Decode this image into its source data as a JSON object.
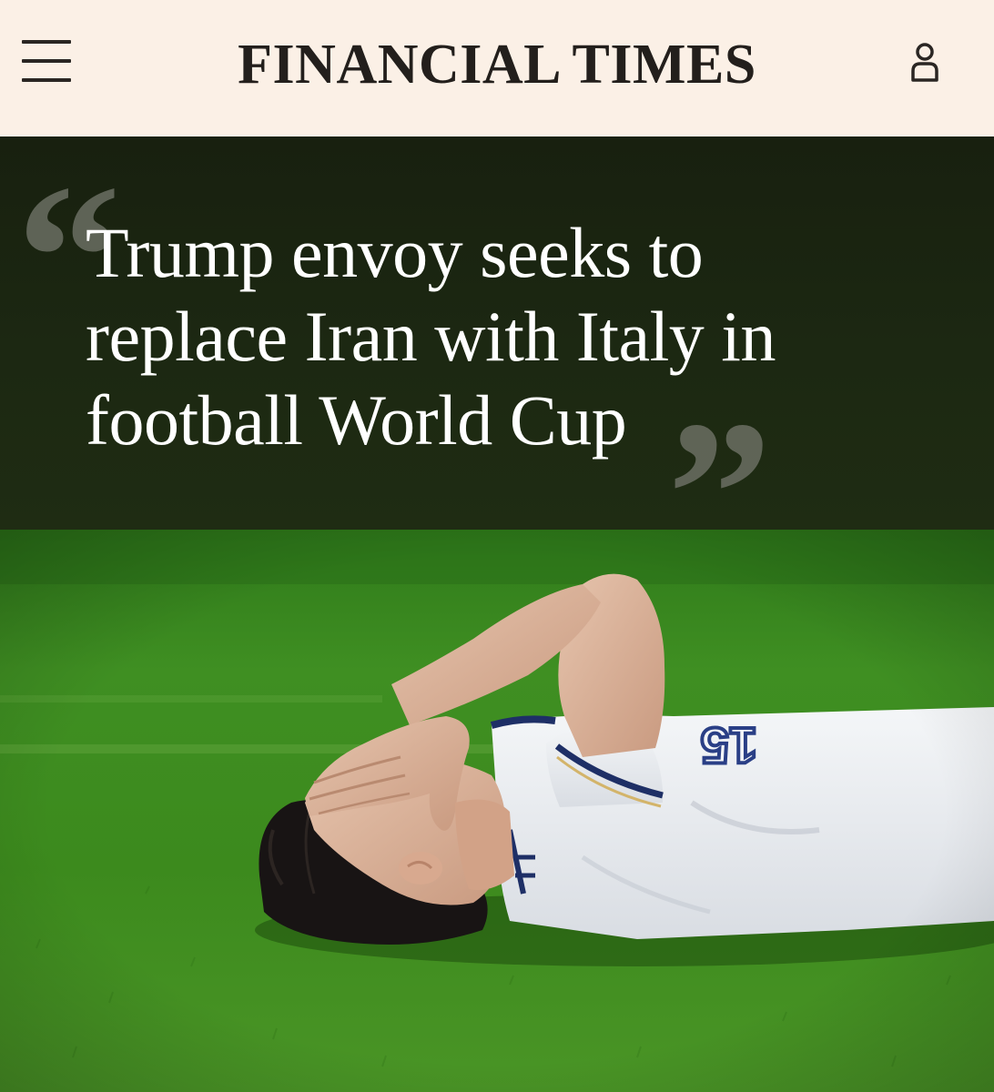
{
  "header": {
    "masthead": "FINANCIAL TIMES",
    "menu_icon": "hamburger-menu-icon",
    "account_icon": "user-account-icon"
  },
  "article": {
    "headline": "Trump envoy seeks to replace Iran with Italy in football World Cup",
    "open_quote": "“",
    "close_quote": "”"
  },
  "photo": {
    "jersey_number": "15"
  },
  "colors": {
    "header_bg": "#fbf0e6",
    "masthead_text": "#231f1c",
    "headline_panel_bg": "#1c2812",
    "headline_text": "#ffffff",
    "quote_marks": "#6b6f63",
    "pitch_green": "#3f8a1e"
  }
}
